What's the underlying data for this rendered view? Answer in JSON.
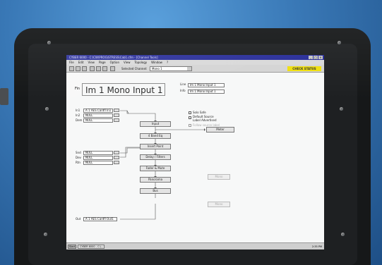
{
  "window": {
    "title": "CYBER 6000 - C:\\CW\\PROG\\STRESS\\Cab1.cfm - [Channel Tools]",
    "controls": [
      "_",
      "□",
      "×"
    ]
  },
  "menu": [
    "File",
    "Edit",
    "View",
    "Page",
    "Option",
    "View",
    "Topology",
    "Window",
    "?"
  ],
  "toolbar": {
    "selected_channel_label": "Selected Channel:",
    "selected_channel_value": "Mono 1",
    "check_status": "CHECK STATUS"
  },
  "channel": {
    "name_label": "Fin",
    "name": "Im 1 Mono Input 1",
    "line_labels": [
      "Line",
      "Info"
    ],
    "line_values": [
      "Im 1 Mono Input 1",
      "Im 1 Mono Input 1"
    ]
  },
  "inputs": [
    {
      "label": "In1",
      "value": "A 1 AES Cardfl In1"
    },
    {
      "label": "In2",
      "value": "NULL"
    },
    {
      "label": "Dem",
      "value": "NULL"
    }
  ],
  "sends": [
    {
      "label": "Snd",
      "value": "NULL"
    },
    {
      "label": "Dev",
      "value": "NULL"
    },
    {
      "label": "Rtn",
      "value": "NULL"
    }
  ],
  "options": [
    {
      "label": "Solo Safe",
      "checked": false
    },
    {
      "label": "Default Source\nLabel Advertised",
      "checked": false
    },
    {
      "label": "Follow source label",
      "checked": true,
      "dim": true
    }
  ],
  "processing_chain": [
    "Input",
    "4 Band Eq",
    "Insert Point",
    "Delay / Filters",
    "Fader & Mute",
    "Panorama",
    "Bus"
  ],
  "meter_label": "Meter",
  "dim_buttons": [
    "Mono",
    "Mono"
  ],
  "output": {
    "label": "Out",
    "value": "A 1 AES Cardfl Out1"
  },
  "taskbar": {
    "start": "Start",
    "task": "CYBER 6000 - C:\\...",
    "time": "2:35 PM"
  },
  "colors": {
    "titlebar": "#2a2f9a",
    "check_status": "#f0e010",
    "screen_bg": "#f7f8f8"
  }
}
